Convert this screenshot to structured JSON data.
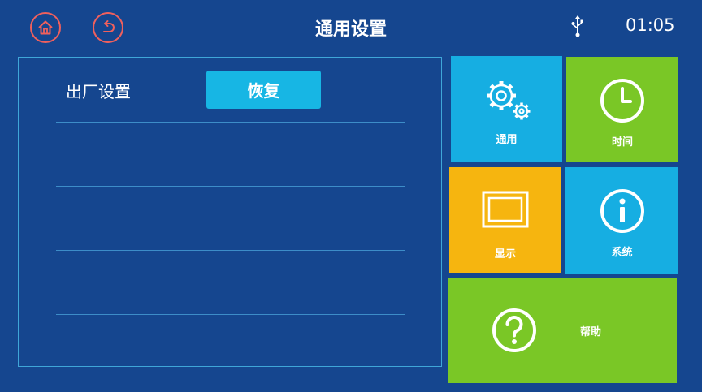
{
  "header": {
    "title": "通用设置",
    "time": "01:05"
  },
  "settings": {
    "factory_label": "出厂设置",
    "restore_button": "恢复"
  },
  "tiles": {
    "general": "通用",
    "time": "时间",
    "display": "显示",
    "system": "系统",
    "help": "帮助"
  },
  "colors": {
    "background": "#15468f",
    "cyan_tile": "#16aee2",
    "green_tile": "#7ac726",
    "yellow_tile": "#f6b50f",
    "header_icon_ring": "#f0605d"
  },
  "icons": {
    "header": [
      "home-icon",
      "back-icon",
      "usb-icon"
    ],
    "tiles": [
      "gear-icon",
      "clock-icon",
      "monitor-icon",
      "info-icon",
      "help-icon"
    ]
  }
}
